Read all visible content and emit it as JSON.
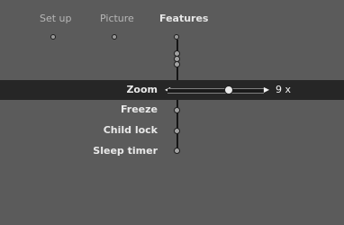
{
  "tabs": {
    "setup": "Set up",
    "picture": "Picture",
    "features": "Features"
  },
  "menu": {
    "zoom_label": "Zoom",
    "freeze_label": "Freeze",
    "child_lock_label": "Child lock",
    "sleep_timer_label": "Sleep timer"
  },
  "zoom": {
    "value": "9 x",
    "level_fraction": 0.64
  },
  "colors": {
    "background": "#5b5b5b",
    "selected_row": "#262626",
    "text_primary": "#e9e9e9",
    "text_secondary": "#b7b7b7"
  }
}
